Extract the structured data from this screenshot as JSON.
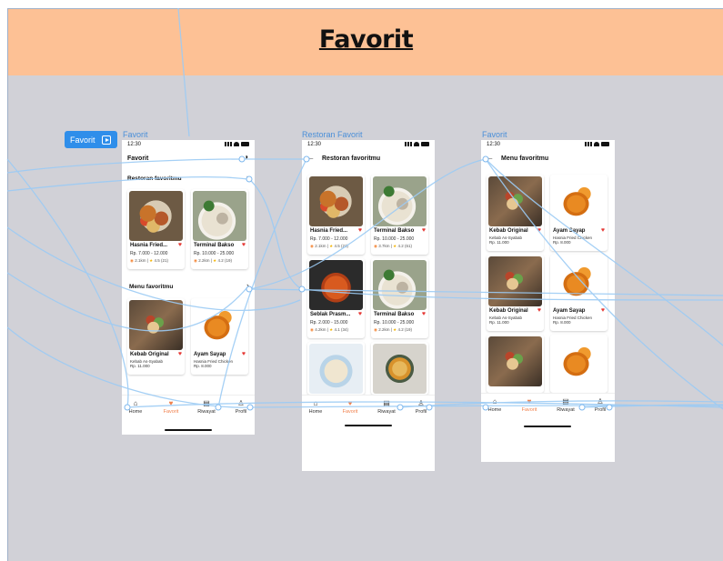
{
  "banner": {
    "title": "Favorit"
  },
  "frame_badge": {
    "label": "Favorit",
    "icon": "play-icon"
  },
  "frames": {
    "favorit": {
      "label": "Favorit",
      "status_time": "12:30",
      "title": "Favorit",
      "section_restaurants": "Restoran favoritmu",
      "section_menus": "Menu favoritmu",
      "restaurants": [
        {
          "name": "Hasnia Fried...",
          "price": "Rp. 7.000 - 12.000",
          "distance": "2.1km",
          "rating": "4.5 (21)"
        },
        {
          "name": "Terminal Bakso",
          "price": "Rp. 10.000 - 25.000",
          "distance": "2.2km",
          "rating": "4.2 (19)"
        }
      ],
      "menus": [
        {
          "name": "Kebab Original",
          "shop": "Kebab As-Syabab",
          "price": "Rp. 11.000"
        },
        {
          "name": "Ayam Sayap",
          "shop": "Hasnia Fried Chicken",
          "price": "Rp. 8.000"
        }
      ]
    },
    "restoran": {
      "label": "Restoran Favorit",
      "status_time": "12:30",
      "title": "Restoran favoritmu",
      "items": [
        {
          "name": "Hasnia Fried...",
          "price": "Rp. 7.000 - 12.000",
          "distance": "2.1km",
          "rating": "4.5 (21)"
        },
        {
          "name": "Terminal Bakso",
          "price": "Rp. 10.000 - 25.000",
          "distance": "3.7km",
          "rating": "4.2 (61)"
        },
        {
          "name": "Seblak Prasm...",
          "price": "Rp. 2.000 - 15.000",
          "distance": "4.2km",
          "rating": "4.1 (34)"
        },
        {
          "name": "Terminal Bakso",
          "price": "Rp. 10.000 - 25.000",
          "distance": "2.2km",
          "rating": "4.2 (19)"
        }
      ]
    },
    "menu": {
      "label": "Favorit",
      "status_time": "12:30",
      "title": "Menu favoritmu",
      "items": [
        {
          "name": "Kebab Original",
          "shop": "Kebab As-Syabab",
          "price": "Rp. 11.000"
        },
        {
          "name": "Ayam Sayap",
          "shop": "Hasnia Fried Chicken",
          "price": "Rp. 8.000"
        },
        {
          "name": "Kebab Original",
          "shop": "Kebab As-Syabab",
          "price": "Rp. 11.000"
        },
        {
          "name": "Ayam Sayap",
          "shop": "Hasnia Fried Chicken",
          "price": "Rp. 8.000"
        }
      ]
    }
  },
  "nav": {
    "home": "Home",
    "favorit": "Favorit",
    "riwayat": "Riwayat",
    "profil": "Profil"
  },
  "colors": {
    "banner": "#fdc195",
    "canvas": "#d1d1d7",
    "accent": "#f07f4b",
    "heart": "#e53935",
    "prototype_link": "#9ccbf4",
    "badge": "#2f8eea"
  }
}
